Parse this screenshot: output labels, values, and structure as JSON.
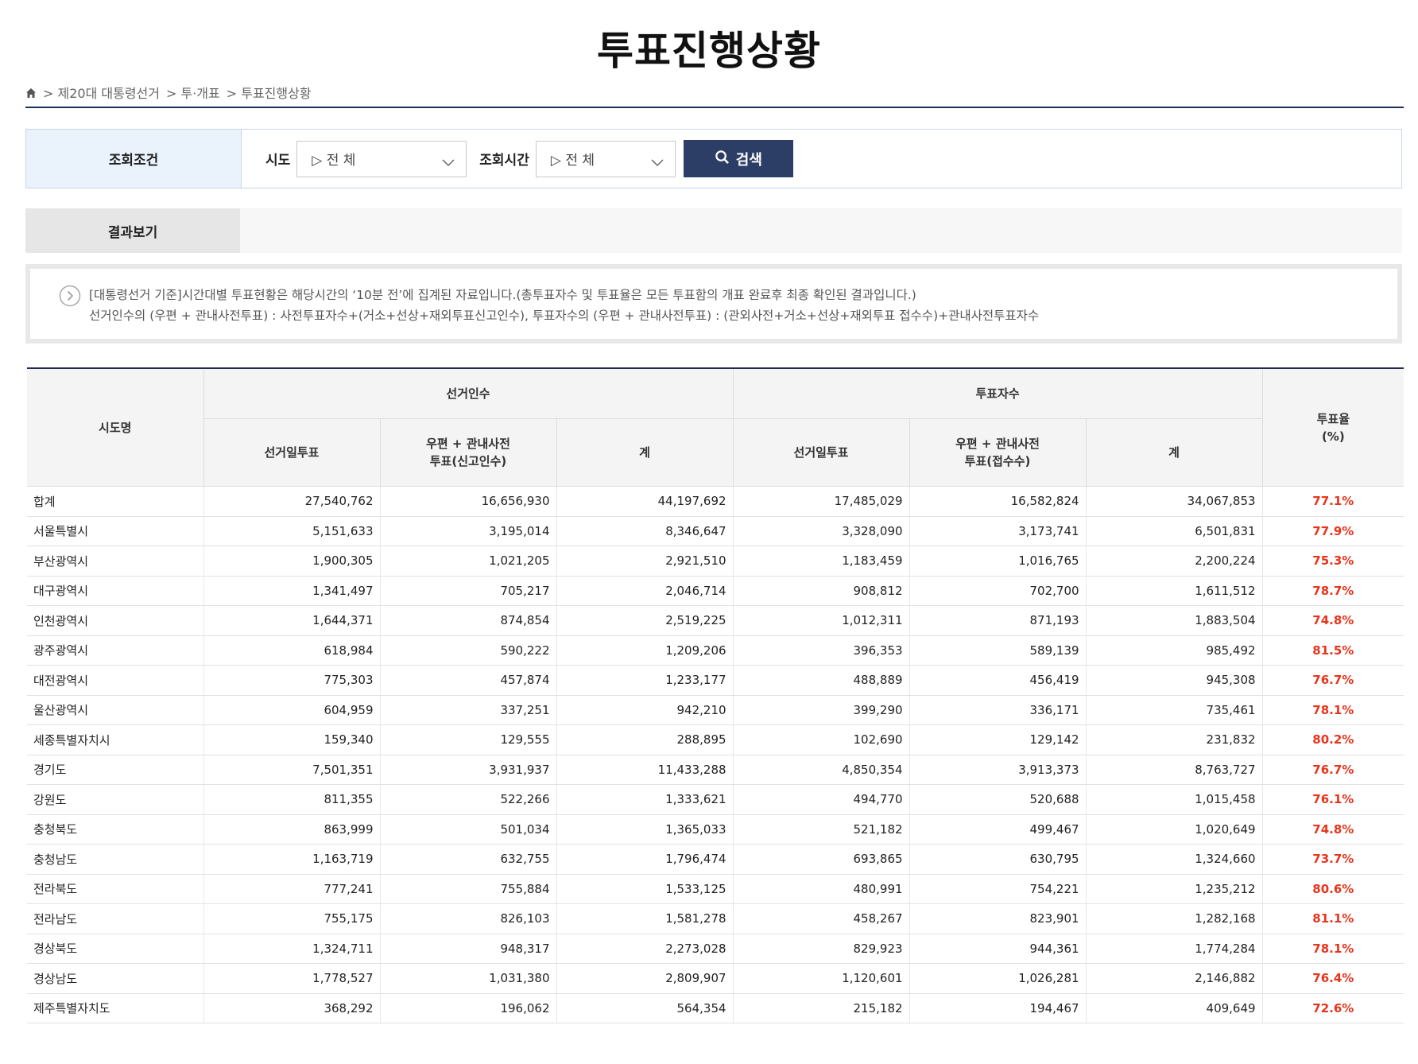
{
  "page": {
    "title": "투표진행상황"
  },
  "breadcrumb": {
    "items": [
      "> 제20대 대통령선거",
      "> 투·개표",
      "> 투표진행상황"
    ]
  },
  "search": {
    "label": "조회조건",
    "sido_label": "시도",
    "sido_value": "▷ 전 체",
    "time_label": "조회시간",
    "time_value": "▷ 전 체",
    "button_label": "검색"
  },
  "result_tab": {
    "label": "결과보기"
  },
  "notice": {
    "line1": "[대통령선거 기준]시간대별 투표현황은 해당시간의 ‘10분 전’에 집계된 자료입니다.(총투표자수 및 투표율은 모든 투표함의 개표 완료후 최종 확인된 결과입니다.)",
    "line2": "선거인수의 (우편 + 관내사전투표) : 사전투표자수+(거소+선상+재외투표신고인수), 투표자수의 (우편 + 관내사전투표) : (관외사전+거소+선상+재외투표 접수수)+관내사전투표자수"
  },
  "table": {
    "headers": {
      "region": "시도명",
      "electorate": "선거인수",
      "voters": "투표자수",
      "rate_line1": "투표율",
      "rate_line2": "(%)",
      "e_day": "선거일투표",
      "e_mail_line1": "우편 + 관내사전",
      "e_mail_line2": "투표(신고인수)",
      "e_total": "계",
      "v_day": "선거일투표",
      "v_mail_line1": "우편 + 관내사전",
      "v_mail_line2": "투표(접수수)",
      "v_total": "계"
    },
    "rows": [
      [
        "합계",
        "27,540,762",
        "16,656,930",
        "44,197,692",
        "17,485,029",
        "16,582,824",
        "34,067,853",
        "77.1%"
      ],
      [
        "서울특별시",
        "5,151,633",
        "3,195,014",
        "8,346,647",
        "3,328,090",
        "3,173,741",
        "6,501,831",
        "77.9%"
      ],
      [
        "부산광역시",
        "1,900,305",
        "1,021,205",
        "2,921,510",
        "1,183,459",
        "1,016,765",
        "2,200,224",
        "75.3%"
      ],
      [
        "대구광역시",
        "1,341,497",
        "705,217",
        "2,046,714",
        "908,812",
        "702,700",
        "1,611,512",
        "78.7%"
      ],
      [
        "인천광역시",
        "1,644,371",
        "874,854",
        "2,519,225",
        "1,012,311",
        "871,193",
        "1,883,504",
        "74.8%"
      ],
      [
        "광주광역시",
        "618,984",
        "590,222",
        "1,209,206",
        "396,353",
        "589,139",
        "985,492",
        "81.5%"
      ],
      [
        "대전광역시",
        "775,303",
        "457,874",
        "1,233,177",
        "488,889",
        "456,419",
        "945,308",
        "76.7%"
      ],
      [
        "울산광역시",
        "604,959",
        "337,251",
        "942,210",
        "399,290",
        "336,171",
        "735,461",
        "78.1%"
      ],
      [
        "세종특별자치시",
        "159,340",
        "129,555",
        "288,895",
        "102,690",
        "129,142",
        "231,832",
        "80.2%"
      ],
      [
        "경기도",
        "7,501,351",
        "3,931,937",
        "11,433,288",
        "4,850,354",
        "3,913,373",
        "8,763,727",
        "76.7%"
      ],
      [
        "강원도",
        "811,355",
        "522,266",
        "1,333,621",
        "494,770",
        "520,688",
        "1,015,458",
        "76.1%"
      ],
      [
        "충청북도",
        "863,999",
        "501,034",
        "1,365,033",
        "521,182",
        "499,467",
        "1,020,649",
        "74.8%"
      ],
      [
        "충청남도",
        "1,163,719",
        "632,755",
        "1,796,474",
        "693,865",
        "630,795",
        "1,324,660",
        "73.7%"
      ],
      [
        "전라북도",
        "777,241",
        "755,884",
        "1,533,125",
        "480,991",
        "754,221",
        "1,235,212",
        "80.6%"
      ],
      [
        "전라남도",
        "755,175",
        "826,103",
        "1,581,278",
        "458,267",
        "823,901",
        "1,282,168",
        "81.1%"
      ],
      [
        "경상북도",
        "1,324,711",
        "948,317",
        "2,273,028",
        "829,923",
        "944,361",
        "1,774,284",
        "78.1%"
      ],
      [
        "경상남도",
        "1,778,527",
        "1,031,380",
        "2,809,907",
        "1,120,601",
        "1,026,281",
        "2,146,882",
        "76.4%"
      ],
      [
        "제주특별자치도",
        "368,292",
        "196,062",
        "564,354",
        "215,182",
        "194,467",
        "409,649",
        "72.6%"
      ]
    ]
  },
  "colors": {
    "accent": "#2c3e66",
    "rate": "#e8341c",
    "label_bg": "#eaf3fc"
  },
  "icons": {
    "home": "home-icon",
    "search": "search-icon",
    "dropdown": "chevron-down-icon",
    "notice": "chevron-right-circle-icon"
  }
}
